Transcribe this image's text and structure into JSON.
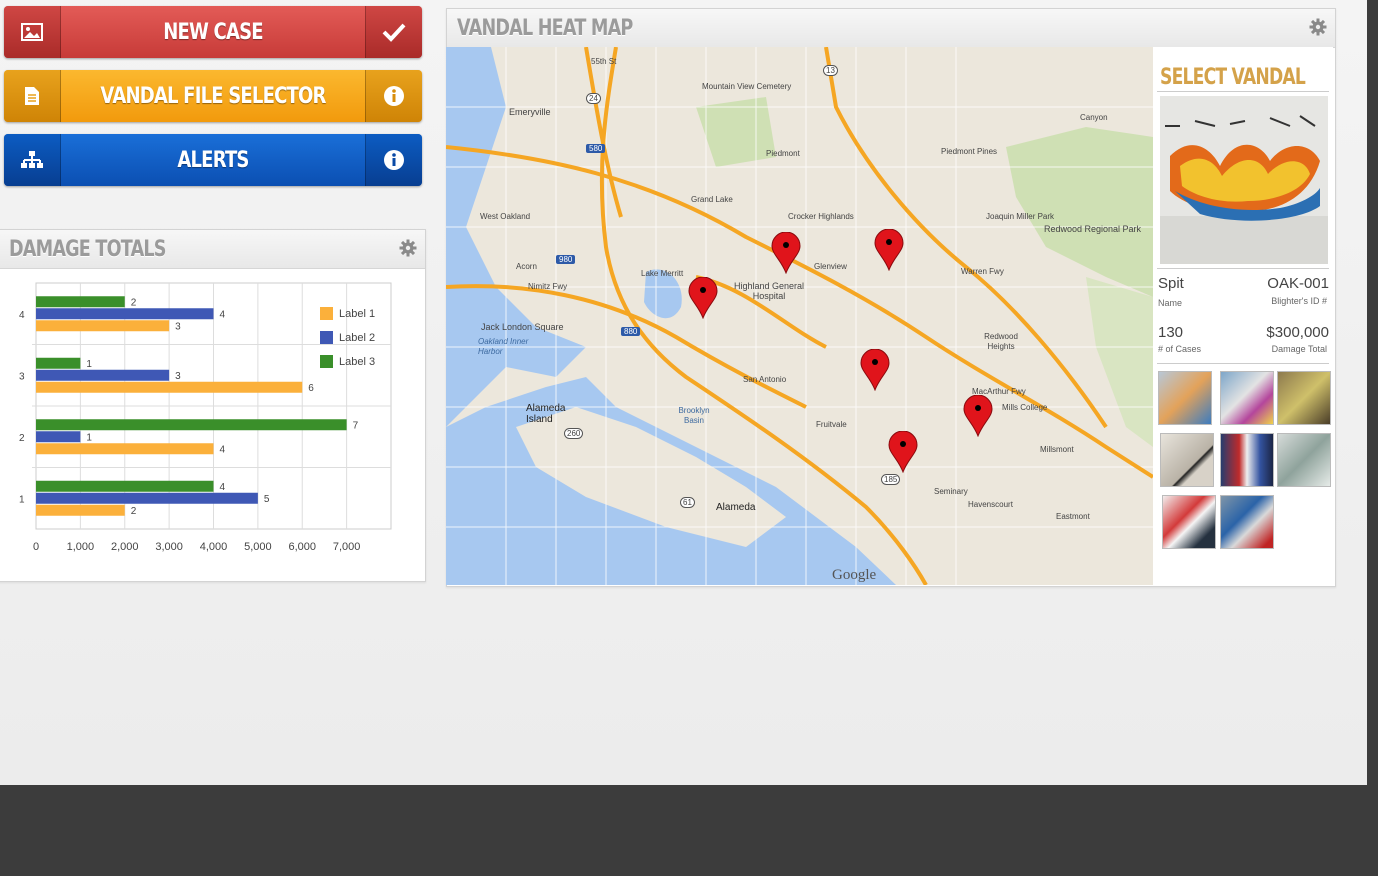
{
  "buttons": {
    "new_case": {
      "label": "NEW CASE",
      "icon": "image-icon",
      "end_icon": "check-icon"
    },
    "vandal_file_selector": {
      "label": "VANDAL FILE SELECTOR",
      "icon": "document-icon",
      "end_icon": "info-icon"
    },
    "alerts": {
      "label": "ALERTS",
      "icon": "sitemap-icon",
      "end_icon": "info-icon"
    }
  },
  "damage_totals": {
    "title": "DAMAGE TOTALS",
    "settings_icon": "gear-icon"
  },
  "chart_data": {
    "type": "bar",
    "orientation": "horizontal",
    "categories": [
      "1",
      "2",
      "3",
      "4"
    ],
    "series": [
      {
        "name": "Label 1",
        "color": "#fbb03b",
        "values": [
          2,
          4,
          6,
          3
        ]
      },
      {
        "name": "Label 2",
        "color": "#3f58b5",
        "values": [
          5,
          1,
          3,
          4
        ]
      },
      {
        "name": "Label 3",
        "color": "#3a8f2a",
        "values": [
          4,
          7,
          1,
          2
        ]
      }
    ],
    "x_tick_labels": [
      "0",
      "1,000",
      "2,000",
      "3,000",
      "4,000",
      "5,000",
      "6,000",
      "7,000"
    ],
    "xlim": [
      0,
      8
    ],
    "grid": true,
    "legend_position": "top-right"
  },
  "heat_map": {
    "title": "VANDAL HEAT MAP",
    "settings_icon": "gear-icon",
    "attribution": "Google",
    "place_labels": [
      "55th St",
      "Emeryville",
      "Mountain View Cemetery",
      "Piedmont",
      "Piedmont Pines",
      "Canyon",
      "West Oakland",
      "Grand Lake",
      "Crocker Highlands",
      "Joaquin Miller Park",
      "Redwood Regional Park",
      "Highland General Hospital",
      "Glenview",
      "Acorn",
      "Lake Merritt",
      "Jack London Square",
      "Oakland Inner Harbor",
      "Redwood Heights",
      "Alameda Island",
      "Brooklyn Basin",
      "San Antonio",
      "Fruitvale",
      "Mills College",
      "Millsmont",
      "Seminary",
      "Havenscourt",
      "Eastmont",
      "Alameda",
      "MacArthur Fwy",
      "Nimitz Fwy",
      "Warren Fwy"
    ],
    "highway_shields": [
      "580",
      "980",
      "880",
      "24",
      "13",
      "185",
      "61",
      "260"
    ],
    "pin_count": 6
  },
  "select_vandal": {
    "title": "SELECT VANDAL",
    "name": "Spit",
    "name_label": "Name",
    "id": "OAK-001",
    "id_label": "Blighter's ID #",
    "cases": "130",
    "cases_label": "# of Cases",
    "damage": "$300,000",
    "damage_label": "Damage Total",
    "thumbnail_count": 8
  }
}
